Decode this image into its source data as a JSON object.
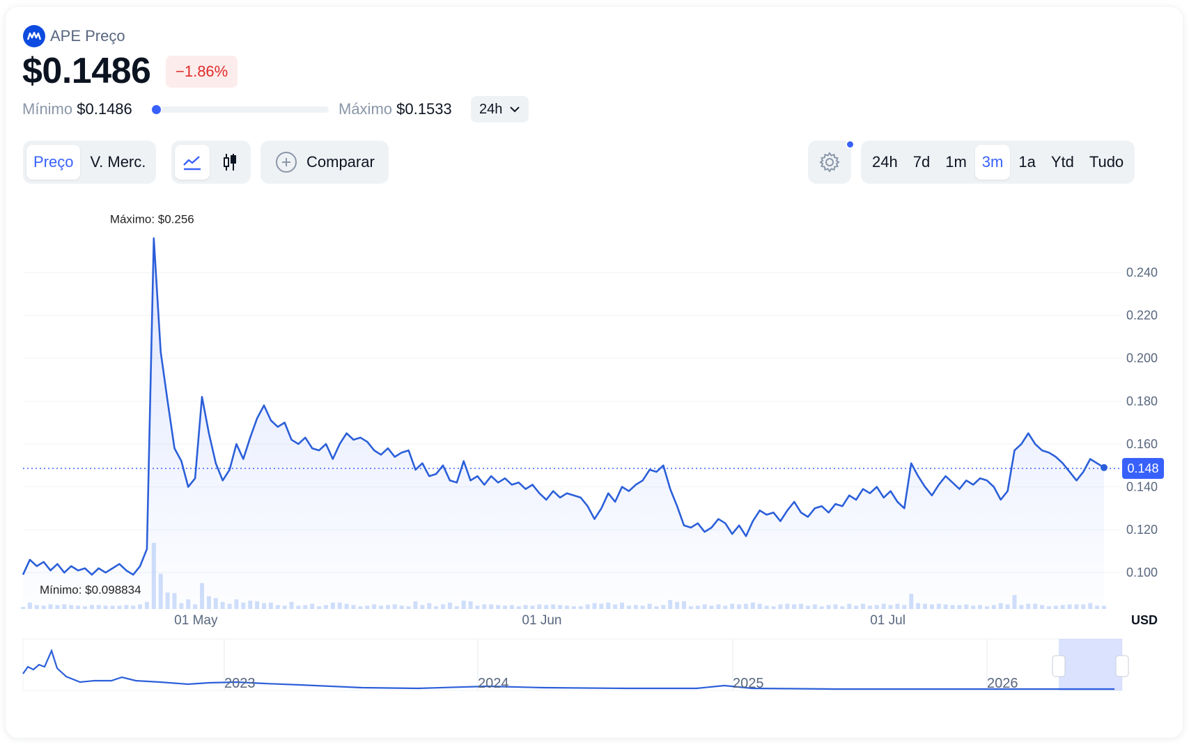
{
  "header": {
    "title": "APE Preço",
    "price": "$0.1486",
    "change": "−1.86%"
  },
  "range": {
    "min_label": "Mínimo",
    "min_value": "$0.1486",
    "max_label": "Máximo",
    "max_value": "$0.1533",
    "period": "24h",
    "position_fraction": 0.0
  },
  "toolbar": {
    "metric_tabs": [
      {
        "label": "Preço",
        "active": true
      },
      {
        "label": "V. Merc.",
        "active": false
      }
    ],
    "chart_type_icons": [
      "line-chart-icon",
      "candlestick-icon"
    ],
    "compare_label": "Comparar",
    "periods": [
      {
        "label": "24h",
        "active": false
      },
      {
        "label": "7d",
        "active": false
      },
      {
        "label": "1m",
        "active": false
      },
      {
        "label": "3m",
        "active": true
      },
      {
        "label": "1a",
        "active": false
      },
      {
        "label": "Ytd",
        "active": false
      },
      {
        "label": "Tudo",
        "active": false
      }
    ]
  },
  "colors": {
    "accent": "#3861fb",
    "line": "#2b5fd9",
    "negative": "#e02a2a"
  },
  "chart_data": {
    "type": "line",
    "x_labels": [
      "01 May",
      "01 Jun",
      "01 Jul"
    ],
    "y_ticks": [
      0.1,
      0.12,
      0.14,
      0.16,
      0.18,
      0.2,
      0.22,
      0.24
    ],
    "ylim": [
      0.083,
      0.26
    ],
    "unit": "USD",
    "max_annotation": "Máximo: $0.256",
    "min_annotation": "Mínimo: $0.098834",
    "current_value_label": "0.148",
    "current_value": 0.1486,
    "grid": true,
    "series": [
      {
        "values": [
          0.099,
          0.106,
          0.103,
          0.105,
          0.101,
          0.104,
          0.1,
          0.103,
          0.101,
          0.102,
          0.099,
          0.102,
          0.1,
          0.102,
          0.104,
          0.101,
          0.099,
          0.103,
          0.111,
          0.256,
          0.203,
          0.18,
          0.158,
          0.152,
          0.14,
          0.144,
          0.182,
          0.165,
          0.151,
          0.143,
          0.148,
          0.16,
          0.153,
          0.163,
          0.172,
          0.178,
          0.171,
          0.168,
          0.17,
          0.162,
          0.16,
          0.163,
          0.158,
          0.157,
          0.16,
          0.153,
          0.16,
          0.165,
          0.162,
          0.163,
          0.161,
          0.157,
          0.155,
          0.158,
          0.154,
          0.156,
          0.157,
          0.148,
          0.151,
          0.145,
          0.146,
          0.15,
          0.143,
          0.142,
          0.152,
          0.143,
          0.145,
          0.141,
          0.145,
          0.142,
          0.144,
          0.141,
          0.142,
          0.139,
          0.141,
          0.137,
          0.134,
          0.138,
          0.135,
          0.137,
          0.136,
          0.135,
          0.131,
          0.125,
          0.13,
          0.137,
          0.133,
          0.14,
          0.138,
          0.141,
          0.143,
          0.148,
          0.147,
          0.15,
          0.139,
          0.131,
          0.122,
          0.121,
          0.123,
          0.119,
          0.121,
          0.125,
          0.123,
          0.118,
          0.122,
          0.117,
          0.124,
          0.129,
          0.127,
          0.128,
          0.124,
          0.129,
          0.133,
          0.128,
          0.126,
          0.13,
          0.131,
          0.128,
          0.132,
          0.131,
          0.136,
          0.134,
          0.139,
          0.137,
          0.14,
          0.135,
          0.138,
          0.133,
          0.13,
          0.151,
          0.145,
          0.14,
          0.136,
          0.141,
          0.145,
          0.142,
          0.139,
          0.143,
          0.141,
          0.144,
          0.143,
          0.14,
          0.134,
          0.138,
          0.157,
          0.16,
          0.165,
          0.16,
          0.157,
          0.156,
          0.154,
          0.151,
          0.147,
          0.143,
          0.147,
          0.153,
          0.151,
          0.149
        ]
      }
    ],
    "navigator_x_labels": [
      "2023",
      "2024",
      "2025",
      "2026"
    ]
  }
}
